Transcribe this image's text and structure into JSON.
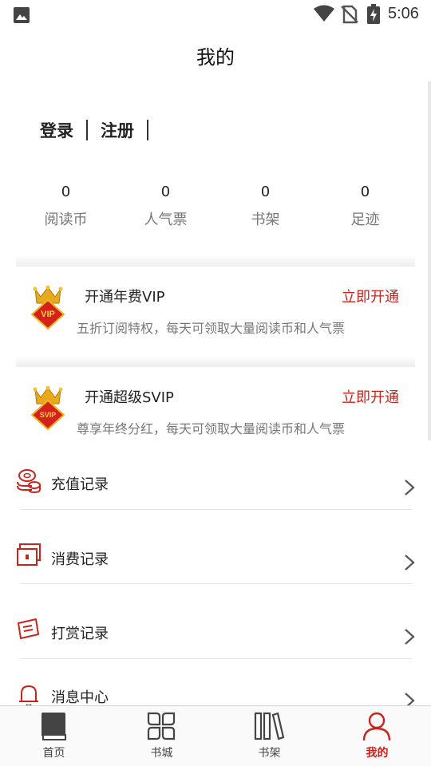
{
  "status_bar": {
    "time": "5:06"
  },
  "header": {
    "title": "我的"
  },
  "auth": {
    "login": "登录",
    "register": "注册"
  },
  "stats": [
    {
      "value": "0",
      "label": "阅读币"
    },
    {
      "value": "0",
      "label": "人气票"
    },
    {
      "value": "0",
      "label": "书架"
    },
    {
      "value": "0",
      "label": "足迹"
    }
  ],
  "vip_cards": [
    {
      "badge_text": "VIP",
      "title": "开通年费VIP",
      "action": "立即开通",
      "desc": "五折订阅特权，每天可领取大量阅读币和人气票"
    },
    {
      "badge_text": "SVIP",
      "title": "开通超级SVIP",
      "action": "立即开通",
      "desc": "尊享年终分红，每天可领取大量阅读币和人气票"
    }
  ],
  "menu": [
    {
      "label": "充值记录",
      "icon": "coins-icon"
    },
    {
      "label": "消费记录",
      "icon": "wallet-icon"
    },
    {
      "label": "打赏记录",
      "icon": "reward-card-icon"
    },
    {
      "label": "消息中心",
      "icon": "bell-icon"
    }
  ],
  "tabbar": [
    {
      "label": "首页",
      "icon": "book-icon",
      "active": false
    },
    {
      "label": "书城",
      "icon": "grid-icon",
      "active": false
    },
    {
      "label": "书架",
      "icon": "bookshelf-icon",
      "active": false
    },
    {
      "label": "我的",
      "icon": "user-icon",
      "active": true
    }
  ],
  "colors": {
    "accent": "#c8241c",
    "text": "#222222",
    "muted": "#777777"
  }
}
